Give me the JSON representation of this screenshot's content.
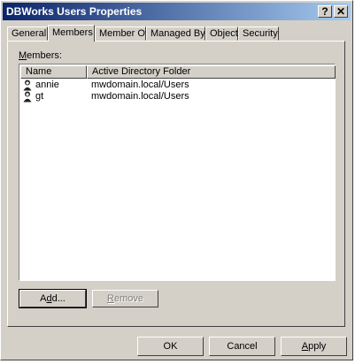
{
  "window": {
    "title": "DBWorks Users Properties",
    "help_label": "?",
    "close_label": "✕"
  },
  "tabs": [
    {
      "label": "General"
    },
    {
      "label": "Members"
    },
    {
      "label": "Member Of"
    },
    {
      "label": "Managed By"
    },
    {
      "label": "Object"
    },
    {
      "label": "Security"
    }
  ],
  "active_tab": "Members",
  "members": {
    "label_mnemonic": "M",
    "label_rest": "embers:",
    "columns": [
      "Name",
      "Active Directory Folder"
    ],
    "rows": [
      {
        "name": "annie",
        "folder": "mwdomain.local/Users",
        "icon": "user-icon"
      },
      {
        "name": "gt",
        "folder": "mwdomain.local/Users",
        "icon": "user-icon"
      }
    ]
  },
  "buttons": {
    "add": {
      "pre": "A",
      "mnemonic": "d",
      "post": "d..."
    },
    "remove": {
      "mnemonic": "R",
      "post": "emove"
    },
    "ok": "OK",
    "cancel": "Cancel",
    "apply": {
      "mnemonic": "A",
      "post": "pply"
    }
  },
  "colors": {
    "face": "#d4d0c8",
    "title_start": "#0a246a",
    "title_end": "#a6caf0"
  }
}
